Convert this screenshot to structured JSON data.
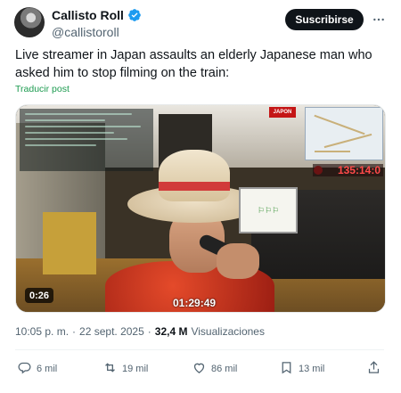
{
  "author": {
    "display_name": "Callisto Roll",
    "handle": "@callistoroll",
    "verified_icon": "verified-badge-icon",
    "verified_color": "#1d9bf0"
  },
  "header": {
    "subscribe_label": "Suscribirse",
    "more_icon": "more-icon"
  },
  "tweet": {
    "text": "Live streamer in Japan assaults an elderly Japanese man who asked him to stop filming on the train:",
    "translate_label": "Traducir post"
  },
  "media": {
    "duration": "0:26",
    "overlay_timestamp": "01:29:49",
    "stream_counter": "135:14:0",
    "japan_tag": "JAPON"
  },
  "meta": {
    "time": "10:05 p. m.",
    "separator": "·",
    "date": "22 sept. 2025",
    "separator2": "·",
    "views_count": "32,4 M",
    "views_label": "Visualizaciones"
  },
  "actions": {
    "replies": "6 mil",
    "reposts": "19 mil",
    "likes": "86 mil",
    "bookmarks": "13 mil"
  },
  "colors": {
    "text_primary": "#0f1419",
    "text_secondary": "#536471",
    "translate_link": "#1d9b50",
    "button_bg": "#0f1419"
  }
}
